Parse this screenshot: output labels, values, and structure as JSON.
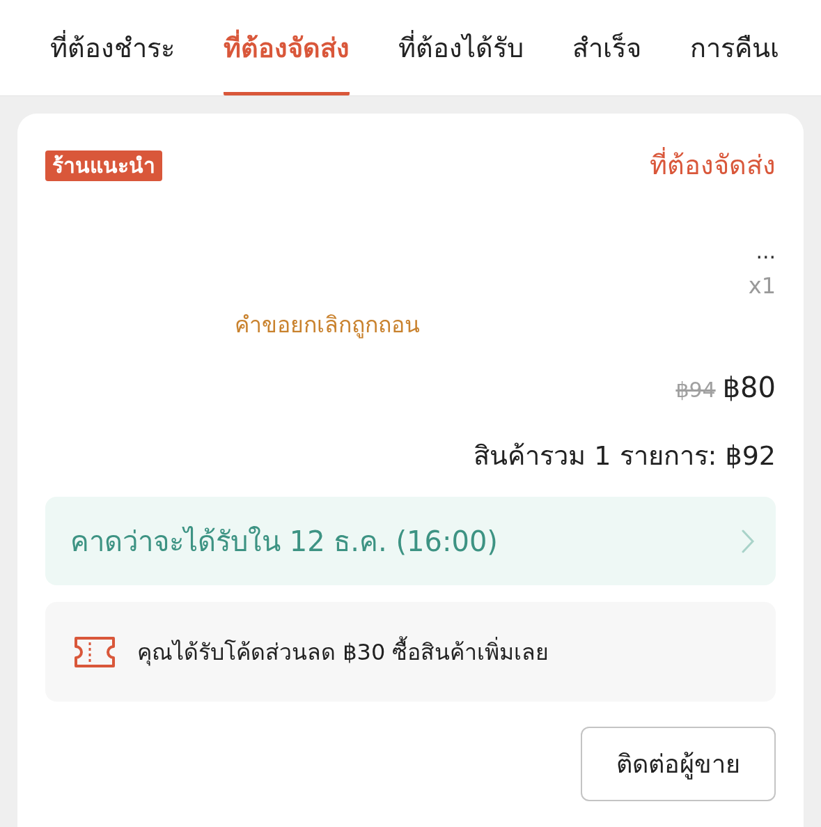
{
  "tabs": [
    {
      "label": "ที่ต้องชำระ",
      "selected": false
    },
    {
      "label": "ที่ต้องจัดส่ง",
      "selected": true
    },
    {
      "label": "ที่ต้องได้รับ",
      "selected": false
    },
    {
      "label": "สำเร็จ",
      "selected": false
    },
    {
      "label": "การคืนเ",
      "selected": false
    }
  ],
  "order": {
    "shop_badge": "ร้านแนะนำ",
    "status": "ที่ต้องจัดส่ง",
    "more": "...",
    "quantity": "x1",
    "note": "คำขอยกเลิกถูกถอน",
    "original_price": "฿94",
    "price": "฿80",
    "total": "สินค้ารวม 1 รายการ: ฿92",
    "delivery": "คาดว่าจะได้รับใน 12 ธ.ค. (16:00)",
    "voucher": "คุณได้รับโค้ดส่วนลด ฿30 ซื้อสินค้าเพิ่มเลย",
    "button": "ติดต่อผู้ขาย"
  }
}
